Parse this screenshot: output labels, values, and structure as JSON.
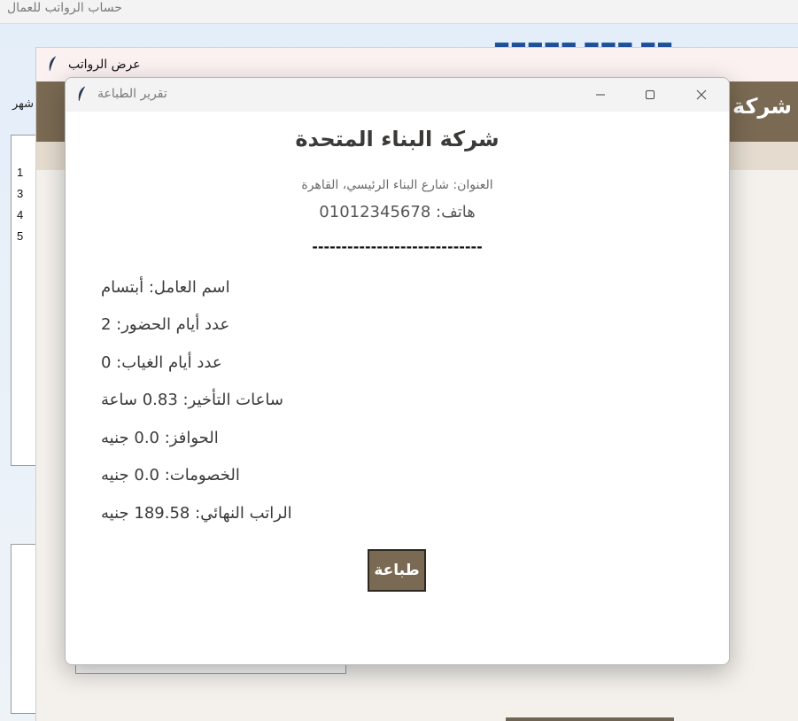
{
  "main_window": {
    "title": "حساب الرواتب للعمال",
    "left_label": "شهر",
    "list_numbers": [
      "1",
      "3",
      "4",
      "5"
    ]
  },
  "salaries_window": {
    "title": "عرض الرواتب",
    "banner": "شركة ا"
  },
  "report_dialog": {
    "title": "تقرير الطباعة",
    "company_name": "شركة البناء المتحدة",
    "address": "العنوان: شارع البناء الرئيسي، القاهرة",
    "phone": "هاتف: 01012345678",
    "separator": "-----------------------------",
    "details": [
      "اسم العامل: أبتسام",
      "عدد أيام الحضور: 2",
      "عدد أيام الغياب: 0",
      "ساعات التأخير: 0.83 ساعة",
      "الحوافز: 0.0 جنيه",
      "الخصومات: 0.0 جنيه",
      "الراتب النهائي: 189.58 جنيه"
    ],
    "print_label": "طباعة"
  }
}
